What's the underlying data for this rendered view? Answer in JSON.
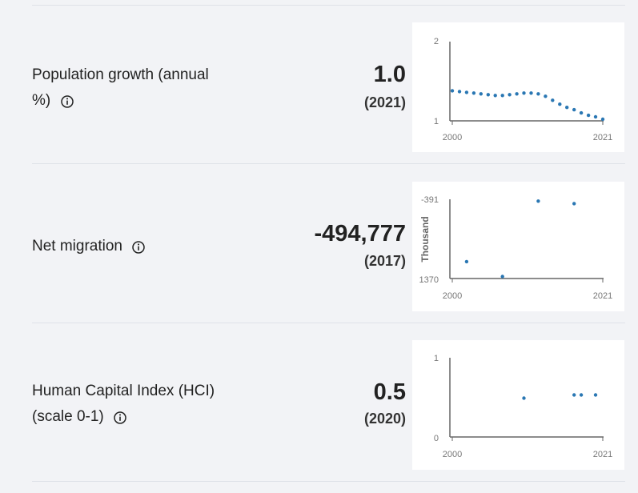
{
  "indicators": [
    {
      "name_line1": "Population growth (annual",
      "name_line2": "%)",
      "value": "1.0",
      "year": "(2021)"
    },
    {
      "name_line1": "Net migration",
      "name_line2": "",
      "value": "-494,777",
      "year": "(2017)"
    },
    {
      "name_line1": "Human Capital Index (HCI)",
      "name_line2": "(scale 0-1)",
      "value": "0.5",
      "year": "(2020)"
    }
  ],
  "chart_data": [
    {
      "type": "scatter",
      "x_ticks": [
        "2000",
        "2021"
      ],
      "y_ticks": [
        "2",
        "1"
      ],
      "ylabel": "",
      "xlim": [
        2000,
        2021
      ],
      "ylim": [
        1,
        2
      ],
      "series": [
        {
          "x": [
            2000,
            2001,
            2002,
            2003,
            2004,
            2005,
            2006,
            2007,
            2008,
            2009,
            2010,
            2011,
            2012,
            2013,
            2014,
            2015,
            2016,
            2017,
            2018,
            2019,
            2020,
            2021
          ],
          "values": [
            1.38,
            1.37,
            1.36,
            1.35,
            1.34,
            1.33,
            1.32,
            1.32,
            1.33,
            1.34,
            1.35,
            1.35,
            1.34,
            1.31,
            1.26,
            1.21,
            1.17,
            1.14,
            1.1,
            1.07,
            1.05,
            1.02
          ]
        }
      ],
      "color": "#2a77b3",
      "grid": false
    },
    {
      "type": "scatter",
      "x_ticks": [
        "2000",
        "2021"
      ],
      "y_ticks": [
        "-391",
        "1370"
      ],
      "ylabel": "Thousand",
      "xlim": [
        2000,
        2021
      ],
      "ylim": [
        1370,
        -391
      ],
      "series": [
        {
          "x": [
            2002,
            2007,
            2012,
            2017
          ],
          "values": [
            994,
            1325,
            -350,
            -295
          ]
        }
      ],
      "color": "#2a77b3",
      "grid": false
    },
    {
      "type": "scatter",
      "x_ticks": [
        "2000",
        "2021"
      ],
      "y_ticks": [
        "1",
        "0"
      ],
      "ylabel": "",
      "xlim": [
        2000,
        2021
      ],
      "ylim": [
        0,
        1
      ],
      "series": [
        {
          "x": [
            2010,
            2017,
            2018,
            2020
          ],
          "values": [
            0.49,
            0.53,
            0.53,
            0.53
          ]
        }
      ],
      "color": "#2a77b3",
      "grid": false
    }
  ]
}
